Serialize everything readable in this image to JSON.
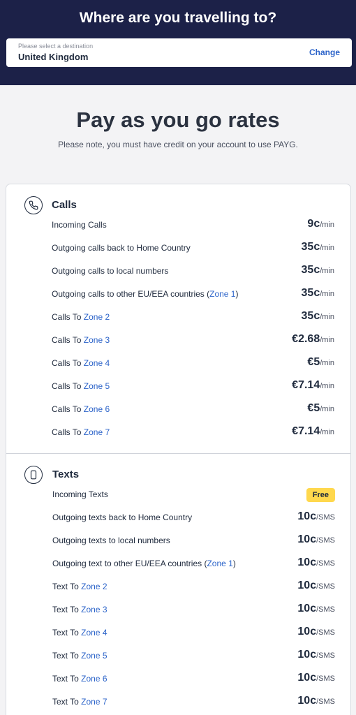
{
  "header": {
    "title": "Where are you travelling to?",
    "destination_placeholder": "Please select a destination",
    "destination_value": "United Kingdom",
    "change_label": "Change"
  },
  "main": {
    "title": "Pay as you go rates",
    "note": "Please note, you must have credit on your account to use PAYG."
  },
  "calls": {
    "title": "Calls",
    "icon": "phone-icon",
    "rows": [
      {
        "label": "Incoming Calls",
        "zone": "",
        "suffix": "",
        "amount": "9c",
        "unit": "/min"
      },
      {
        "label": "Outgoing calls back to Home Country",
        "zone": "",
        "suffix": "",
        "amount": "35c",
        "unit": "/min"
      },
      {
        "label": "Outgoing calls to local numbers",
        "zone": "",
        "suffix": "",
        "amount": "35c",
        "unit": "/min"
      },
      {
        "label": "Outgoing calls to other EU/EEA countries (",
        "zone": "Zone 1",
        "suffix": ")",
        "amount": "35c",
        "unit": "/min"
      },
      {
        "label": "Calls To ",
        "zone": "Zone 2",
        "suffix": "",
        "amount": "35c",
        "unit": "/min"
      },
      {
        "label": "Calls To ",
        "zone": "Zone 3",
        "suffix": "",
        "amount": "€2.68",
        "unit": "/min"
      },
      {
        "label": "Calls To ",
        "zone": "Zone 4",
        "suffix": "",
        "amount": "€5",
        "unit": "/min"
      },
      {
        "label": "Calls To ",
        "zone": "Zone 5",
        "suffix": "",
        "amount": "€7.14",
        "unit": "/min"
      },
      {
        "label": "Calls To ",
        "zone": "Zone 6",
        "suffix": "",
        "amount": "€5",
        "unit": "/min"
      },
      {
        "label": "Calls To ",
        "zone": "Zone 7",
        "suffix": "",
        "amount": "€7.14",
        "unit": "/min"
      }
    ]
  },
  "texts": {
    "title": "Texts",
    "icon": "mobile-phone-icon",
    "free_label": "Free",
    "rows": [
      {
        "label": "Incoming Texts",
        "zone": "",
        "suffix": "",
        "amount": "",
        "unit": ""
      },
      {
        "label": "Outgoing texts back to Home Country",
        "zone": "",
        "suffix": "",
        "amount": "10c",
        "unit": "/SMS"
      },
      {
        "label": "Outgoing texts to local numbers",
        "zone": "",
        "suffix": "",
        "amount": "10c",
        "unit": "/SMS"
      },
      {
        "label": "Outgoing text to other EU/EEA countries (",
        "zone": "Zone 1",
        "suffix": ")",
        "amount": "10c",
        "unit": "/SMS"
      },
      {
        "label": "Text To ",
        "zone": "Zone 2",
        "suffix": "",
        "amount": "10c",
        "unit": "/SMS"
      },
      {
        "label": "Text To ",
        "zone": "Zone 3",
        "suffix": "",
        "amount": "10c",
        "unit": "/SMS"
      },
      {
        "label": "Text To ",
        "zone": "Zone 4",
        "suffix": "",
        "amount": "10c",
        "unit": "/SMS"
      },
      {
        "label": "Text To ",
        "zone": "Zone 5",
        "suffix": "",
        "amount": "10c",
        "unit": "/SMS"
      },
      {
        "label": "Text To ",
        "zone": "Zone 6",
        "suffix": "",
        "amount": "10c",
        "unit": "/SMS"
      },
      {
        "label": "Text To ",
        "zone": "Zone 7",
        "suffix": "",
        "amount": "10c",
        "unit": "/SMS"
      }
    ]
  }
}
